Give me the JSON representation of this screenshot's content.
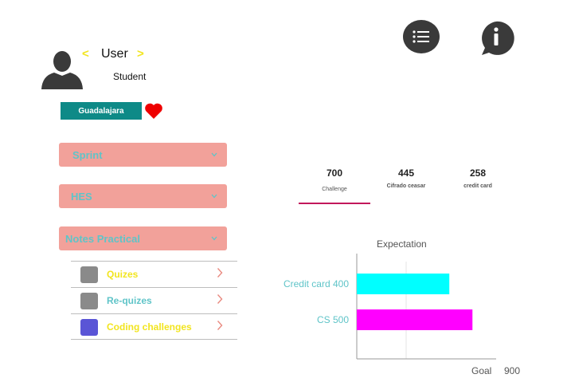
{
  "profile": {
    "prev_glyph": "<",
    "next_glyph": ">",
    "name": "User",
    "role": "Student",
    "city": "Guadalajara"
  },
  "header": {
    "icons": [
      "list-icon",
      "info-icon"
    ]
  },
  "accordions": [
    {
      "label": "Sprint"
    },
    {
      "label": "HES"
    },
    {
      "label": "Notes Practical"
    }
  ],
  "sub_items": [
    {
      "label": "Quizes",
      "color": "#f2e51f",
      "square_color": "#8a8a8a"
    },
    {
      "label": "Re-quizes",
      "color": "#5fc4c8",
      "square_color": "#8a8a8a"
    },
    {
      "label": "Coding challenges",
      "color": "#f2e51f",
      "square_color": "#5a55d6"
    }
  ],
  "tabs": [
    {
      "value": "700",
      "label": "Challenge"
    },
    {
      "value": "445",
      "label": "Cifrado ceasar"
    },
    {
      "value": "258",
      "label": "credit card"
    }
  ],
  "chart_data": {
    "type": "bar",
    "orientation": "horizontal",
    "title": "Expectation",
    "categories": [
      "Credit card 400",
      "CS 500"
    ],
    "values": [
      400,
      500
    ],
    "colors": [
      "#00ffff",
      "#ff00ff"
    ],
    "xlabel": "Goal",
    "xlim": [
      0,
      900
    ],
    "x_tick_labels": [
      "900"
    ],
    "grid": true
  }
}
